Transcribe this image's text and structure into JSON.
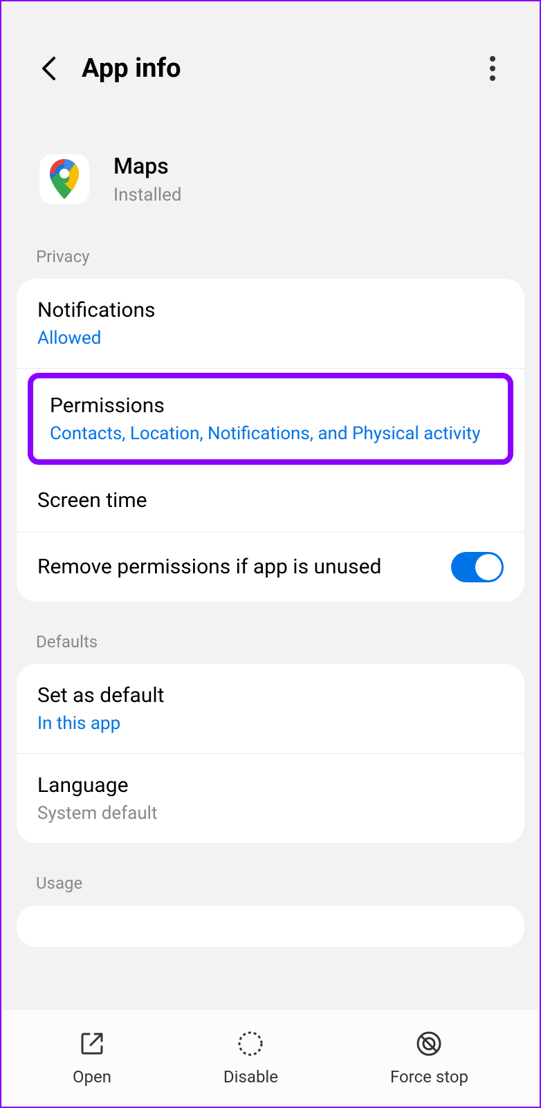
{
  "header": {
    "title": "App info"
  },
  "app": {
    "name": "Maps",
    "status": "Installed"
  },
  "sections": {
    "privacy": {
      "label": "Privacy",
      "notifications": {
        "title": "Notifications",
        "value": "Allowed"
      },
      "permissions": {
        "title": "Permissions",
        "value": "Contacts, Location, Notifications, and Physical activity"
      },
      "screenTime": {
        "title": "Screen time"
      },
      "removePermissions": {
        "title": "Remove permissions if app is unused",
        "enabled": true
      }
    },
    "defaults": {
      "label": "Defaults",
      "setDefault": {
        "title": "Set as default",
        "value": "In this app"
      },
      "language": {
        "title": "Language",
        "sub": "System default"
      }
    },
    "usage": {
      "label": "Usage"
    }
  },
  "bottomBar": {
    "open": "Open",
    "disable": "Disable",
    "forceStop": "Force stop"
  }
}
